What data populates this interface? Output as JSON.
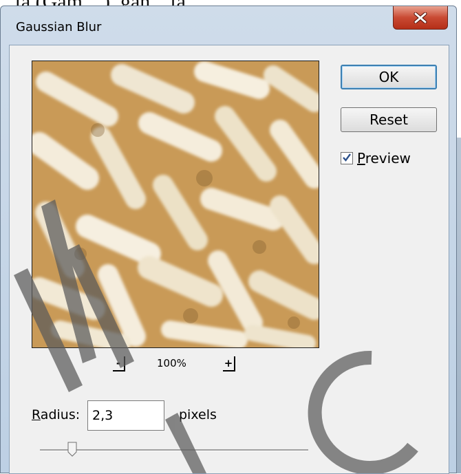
{
  "background": {
    "partial_text": "...ta (Gam...     ), gan... ta"
  },
  "window": {
    "title": "Gaussian Blur"
  },
  "buttons": {
    "ok_label": "OK",
    "reset_label": "Reset"
  },
  "preview_checkbox": {
    "label_underlined": "P",
    "label_rest": "review",
    "checked": true
  },
  "zoom": {
    "minus_label": "-",
    "level": "100%",
    "plus_label": "+"
  },
  "radius": {
    "label_underlined": "R",
    "label_rest": "adius:",
    "value": "2,3",
    "unit": "pixels"
  },
  "slider": {
    "value_fraction": 0.12
  },
  "watermark": {
    "text": "Mai.. Co"
  },
  "colors": {
    "accent": "#3c7fb1",
    "close_red": "#c94a33",
    "title_bar": "#c5d6e8",
    "dialog_bg": "#f0f0f0"
  }
}
